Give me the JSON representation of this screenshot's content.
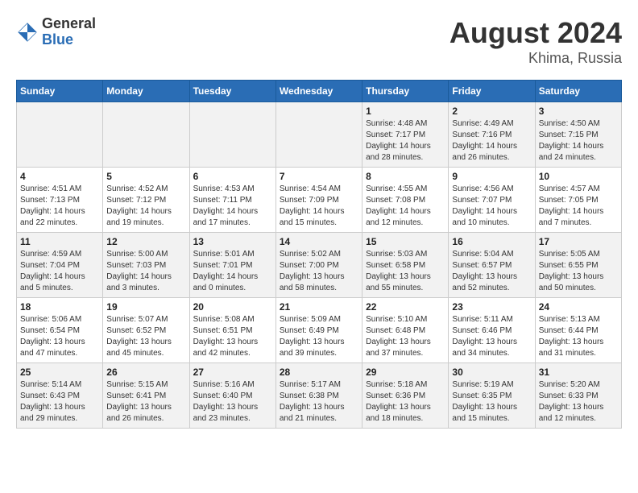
{
  "header": {
    "logo_general": "General",
    "logo_blue": "Blue",
    "title": "August 2024",
    "subtitle": "Khima, Russia"
  },
  "weekdays": [
    "Sunday",
    "Monday",
    "Tuesday",
    "Wednesday",
    "Thursday",
    "Friday",
    "Saturday"
  ],
  "weeks": [
    [
      {
        "day": "",
        "info": ""
      },
      {
        "day": "",
        "info": ""
      },
      {
        "day": "",
        "info": ""
      },
      {
        "day": "",
        "info": ""
      },
      {
        "day": "1",
        "info": "Sunrise: 4:48 AM\nSunset: 7:17 PM\nDaylight: 14 hours\nand 28 minutes."
      },
      {
        "day": "2",
        "info": "Sunrise: 4:49 AM\nSunset: 7:16 PM\nDaylight: 14 hours\nand 26 minutes."
      },
      {
        "day": "3",
        "info": "Sunrise: 4:50 AM\nSunset: 7:15 PM\nDaylight: 14 hours\nand 24 minutes."
      }
    ],
    [
      {
        "day": "4",
        "info": "Sunrise: 4:51 AM\nSunset: 7:13 PM\nDaylight: 14 hours\nand 22 minutes."
      },
      {
        "day": "5",
        "info": "Sunrise: 4:52 AM\nSunset: 7:12 PM\nDaylight: 14 hours\nand 19 minutes."
      },
      {
        "day": "6",
        "info": "Sunrise: 4:53 AM\nSunset: 7:11 PM\nDaylight: 14 hours\nand 17 minutes."
      },
      {
        "day": "7",
        "info": "Sunrise: 4:54 AM\nSunset: 7:09 PM\nDaylight: 14 hours\nand 15 minutes."
      },
      {
        "day": "8",
        "info": "Sunrise: 4:55 AM\nSunset: 7:08 PM\nDaylight: 14 hours\nand 12 minutes."
      },
      {
        "day": "9",
        "info": "Sunrise: 4:56 AM\nSunset: 7:07 PM\nDaylight: 14 hours\nand 10 minutes."
      },
      {
        "day": "10",
        "info": "Sunrise: 4:57 AM\nSunset: 7:05 PM\nDaylight: 14 hours\nand 7 minutes."
      }
    ],
    [
      {
        "day": "11",
        "info": "Sunrise: 4:59 AM\nSunset: 7:04 PM\nDaylight: 14 hours\nand 5 minutes."
      },
      {
        "day": "12",
        "info": "Sunrise: 5:00 AM\nSunset: 7:03 PM\nDaylight: 14 hours\nand 3 minutes."
      },
      {
        "day": "13",
        "info": "Sunrise: 5:01 AM\nSunset: 7:01 PM\nDaylight: 14 hours\nand 0 minutes."
      },
      {
        "day": "14",
        "info": "Sunrise: 5:02 AM\nSunset: 7:00 PM\nDaylight: 13 hours\nand 58 minutes."
      },
      {
        "day": "15",
        "info": "Sunrise: 5:03 AM\nSunset: 6:58 PM\nDaylight: 13 hours\nand 55 minutes."
      },
      {
        "day": "16",
        "info": "Sunrise: 5:04 AM\nSunset: 6:57 PM\nDaylight: 13 hours\nand 52 minutes."
      },
      {
        "day": "17",
        "info": "Sunrise: 5:05 AM\nSunset: 6:55 PM\nDaylight: 13 hours\nand 50 minutes."
      }
    ],
    [
      {
        "day": "18",
        "info": "Sunrise: 5:06 AM\nSunset: 6:54 PM\nDaylight: 13 hours\nand 47 minutes."
      },
      {
        "day": "19",
        "info": "Sunrise: 5:07 AM\nSunset: 6:52 PM\nDaylight: 13 hours\nand 45 minutes."
      },
      {
        "day": "20",
        "info": "Sunrise: 5:08 AM\nSunset: 6:51 PM\nDaylight: 13 hours\nand 42 minutes."
      },
      {
        "day": "21",
        "info": "Sunrise: 5:09 AM\nSunset: 6:49 PM\nDaylight: 13 hours\nand 39 minutes."
      },
      {
        "day": "22",
        "info": "Sunrise: 5:10 AM\nSunset: 6:48 PM\nDaylight: 13 hours\nand 37 minutes."
      },
      {
        "day": "23",
        "info": "Sunrise: 5:11 AM\nSunset: 6:46 PM\nDaylight: 13 hours\nand 34 minutes."
      },
      {
        "day": "24",
        "info": "Sunrise: 5:13 AM\nSunset: 6:44 PM\nDaylight: 13 hours\nand 31 minutes."
      }
    ],
    [
      {
        "day": "25",
        "info": "Sunrise: 5:14 AM\nSunset: 6:43 PM\nDaylight: 13 hours\nand 29 minutes."
      },
      {
        "day": "26",
        "info": "Sunrise: 5:15 AM\nSunset: 6:41 PM\nDaylight: 13 hours\nand 26 minutes."
      },
      {
        "day": "27",
        "info": "Sunrise: 5:16 AM\nSunset: 6:40 PM\nDaylight: 13 hours\nand 23 minutes."
      },
      {
        "day": "28",
        "info": "Sunrise: 5:17 AM\nSunset: 6:38 PM\nDaylight: 13 hours\nand 21 minutes."
      },
      {
        "day": "29",
        "info": "Sunrise: 5:18 AM\nSunset: 6:36 PM\nDaylight: 13 hours\nand 18 minutes."
      },
      {
        "day": "30",
        "info": "Sunrise: 5:19 AM\nSunset: 6:35 PM\nDaylight: 13 hours\nand 15 minutes."
      },
      {
        "day": "31",
        "info": "Sunrise: 5:20 AM\nSunset: 6:33 PM\nDaylight: 13 hours\nand 12 minutes."
      }
    ]
  ]
}
